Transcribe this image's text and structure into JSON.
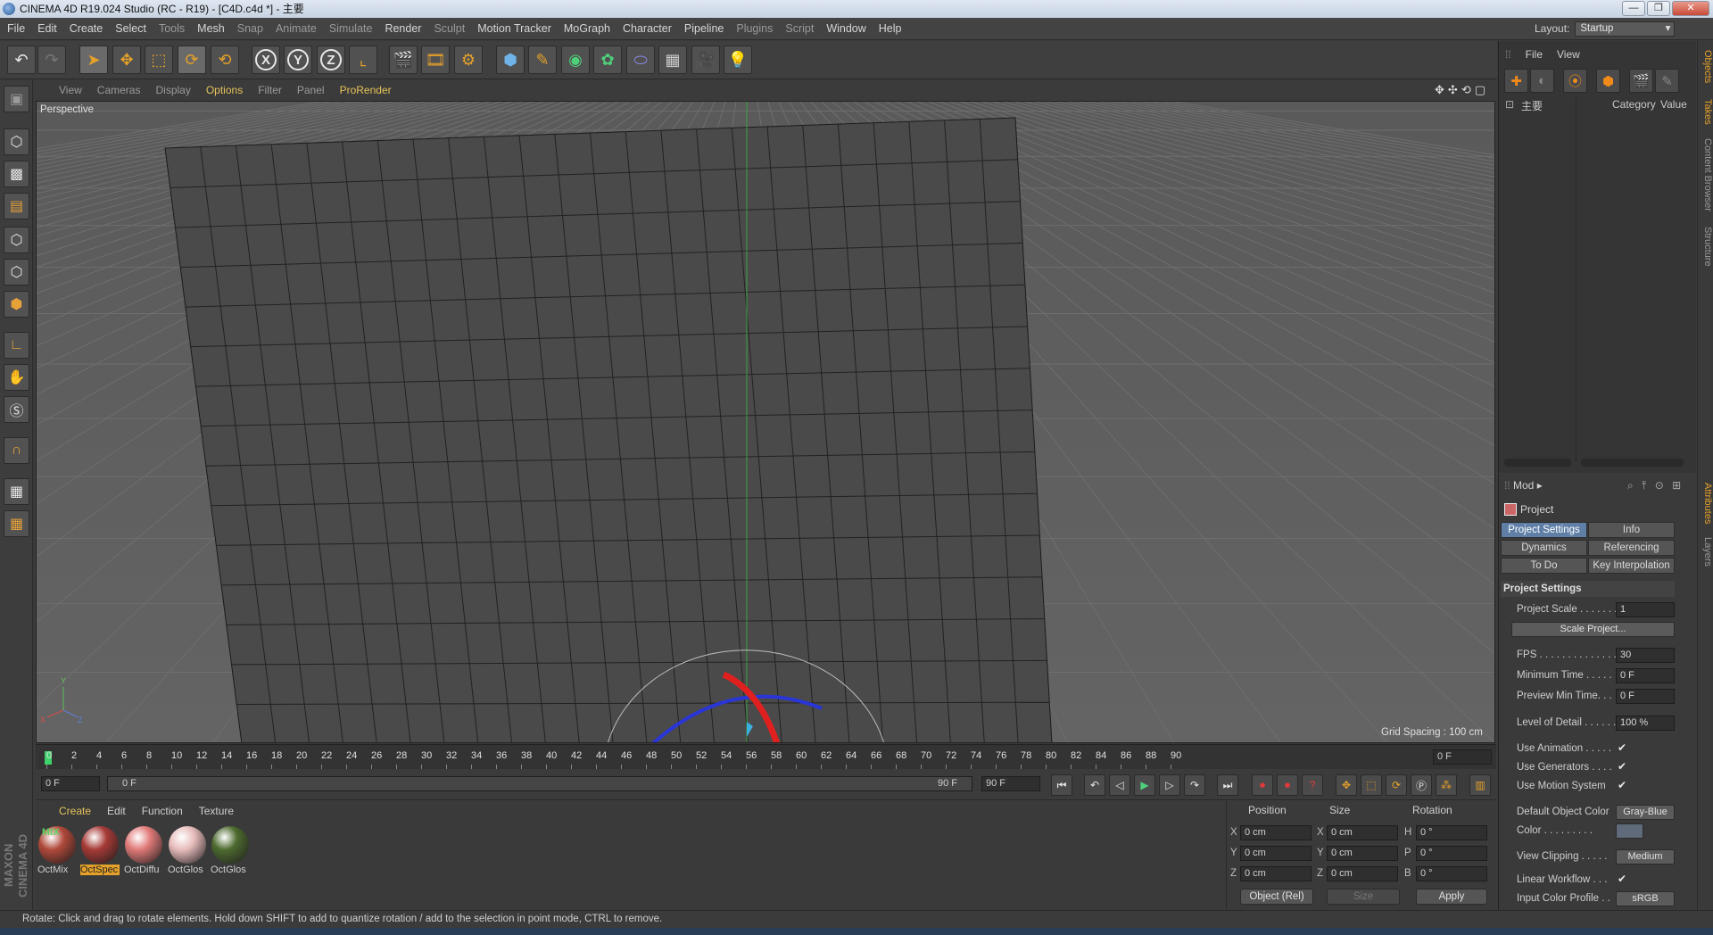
{
  "window": {
    "title": "CINEMA 4D R19.024 Studio (RC - R19) - [C4D.c4d *] - 主要"
  },
  "menubar": [
    "File",
    "Edit",
    "Create",
    "Select",
    "Tools",
    "Mesh",
    "Snap",
    "Animate",
    "Simulate",
    "Render",
    "Sculpt",
    "Motion Tracker",
    "MoGraph",
    "Character",
    "Pipeline",
    "Plugins",
    "Script",
    "Window",
    "Help"
  ],
  "layout": {
    "label": "Layout:",
    "value": "Startup"
  },
  "viewport": {
    "menu": [
      "View",
      "Cameras",
      "Display",
      "Options",
      "Filter",
      "Panel",
      "ProRender"
    ],
    "active_menu": "Options",
    "camera_label": "Perspective",
    "grid_spacing": "Grid Spacing : 100 cm"
  },
  "timeline": {
    "ticks": [
      "0",
      "2",
      "4",
      "6",
      "8",
      "10",
      "12",
      "14",
      "16",
      "18",
      "20",
      "22",
      "24",
      "26",
      "28",
      "30",
      "32",
      "34",
      "36",
      "38",
      "40",
      "42",
      "44",
      "46",
      "48",
      "50",
      "52",
      "54",
      "56",
      "58",
      "60",
      "62",
      "64",
      "66",
      "68",
      "70",
      "72",
      "74",
      "76",
      "78",
      "80",
      "82",
      "84",
      "86",
      "88",
      "90"
    ],
    "end_frame": "0 F",
    "current_frame": "0 F",
    "range_start": "0 F",
    "range_end": "90 F",
    "max_frame": "90 F"
  },
  "material_manager": {
    "menu": [
      "Create",
      "Edit",
      "Function",
      "Texture"
    ],
    "materials": [
      {
        "name": "OctMix",
        "tag": "MIX",
        "color": "#b0493a"
      },
      {
        "name": "OctSpec",
        "tag": "",
        "color": "#a63a36"
      },
      {
        "name": "OctDiffu",
        "tag": "",
        "color": "#e07a78"
      },
      {
        "name": "OctGlos",
        "tag": "",
        "color": "#e8bcbc"
      },
      {
        "name": "OctGlos",
        "tag": "",
        "color": "#4d6a2f"
      }
    ]
  },
  "coordinates": {
    "headers": [
      "Position",
      "Size",
      "Rotation"
    ],
    "rows": [
      {
        "p_label": "X",
        "p_value": "0 cm",
        "s_label": "X",
        "s_value": "0 cm",
        "r_label": "H",
        "r_value": "0 °"
      },
      {
        "p_label": "Y",
        "p_value": "0 cm",
        "s_label": "Y",
        "s_value": "0 cm",
        "r_label": "P",
        "r_value": "0 °"
      },
      {
        "p_label": "Z",
        "p_value": "0 cm",
        "s_label": "Z",
        "s_value": "0 cm",
        "r_label": "B",
        "r_value": "0 °"
      }
    ],
    "mode": "Object (Rel)",
    "size_mode": "Size",
    "apply": "Apply"
  },
  "status_text": "Rotate: Click and drag to rotate elements. Hold down SHIFT to add to quantize rotation / add to the selection in point mode, CTRL to remove.",
  "objects_panel": {
    "menu": [
      "File",
      "View"
    ],
    "tree_item": "主要",
    "columns": [
      "Category",
      "Value"
    ]
  },
  "side_tabs_top": [
    "Objects",
    "Takes",
    "Content Browser",
    "Structure"
  ],
  "side_tabs_bottom": [
    "Attributes",
    "Layers"
  ],
  "attributes": {
    "mode": "Mod",
    "title": "Project",
    "tabs": [
      "Project Settings",
      "Info",
      "Dynamics",
      "Referencing",
      "To Do",
      "Key Interpolation"
    ],
    "section": "Project Settings",
    "project_scale_label": "Project Scale . . . . . . .",
    "project_scale": "1",
    "scale_button": "Scale Project...",
    "fps_label": "FPS . . . . . . . . . . . . . . .",
    "fps": "30",
    "min_time_label": "Minimum Time . . . . .",
    "min_time": "0 F",
    "preview_min_label": "Preview Min Time. . .",
    "preview_min": "0 F",
    "lod_label": "Level of Detail . . . . . .",
    "lod": "100 %",
    "use_animation": "Use Animation . . . . .",
    "use_generators": "Use Generators . . . .",
    "use_motion": "Use Motion System",
    "default_color_label": "Default Object Color",
    "default_color": "Gray-Blue",
    "color_label": "Color . . . . . . . . .",
    "view_clipping_label": "View Clipping . . . . .",
    "view_clipping": "Medium",
    "linear_workflow": "Linear Workflow . . .",
    "input_profile_label": "Input Color Profile . .",
    "input_profile": "sRGB"
  },
  "colors": {
    "accent": "#e5a12a",
    "selected_tab": "#5f7fa7",
    "viewport_bg": "#555555"
  }
}
